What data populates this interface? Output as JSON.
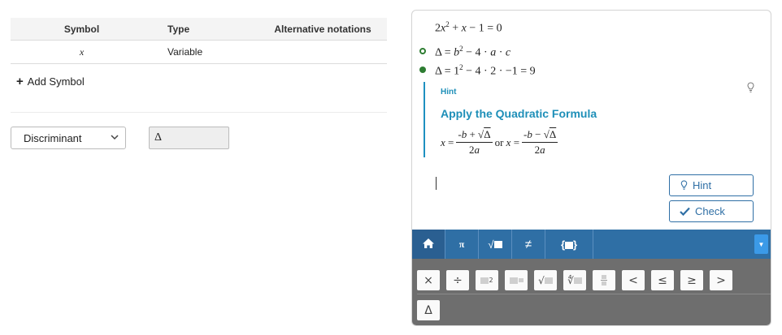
{
  "symbol_table": {
    "headers": [
      "Symbol",
      "Type",
      "Alternative notations"
    ],
    "rows": [
      {
        "symbol": "x",
        "type": "Variable",
        "alt": ""
      }
    ]
  },
  "add_symbol_label": "Add Symbol",
  "symbol_select": {
    "selected": "Discriminant"
  },
  "symbol_value": "Δ",
  "solution": {
    "equation": "2x² + x − 1 = 0",
    "steps": [
      {
        "text": "Δ = b² − 4 · a · c",
        "state": "open"
      },
      {
        "text": "Δ = 1² − 4 · 2 · −1 = 9",
        "state": "done"
      }
    ]
  },
  "hint": {
    "label": "Hint",
    "title": "Apply the Quadratic Formula",
    "formula_connector": "or"
  },
  "buttons": {
    "hint": "Hint",
    "check": "Check"
  },
  "keyboard": {
    "tabs": [
      {
        "icon": "home-icon"
      },
      {
        "label": "π"
      },
      {
        "label": "√▪"
      },
      {
        "label": "≠"
      },
      {
        "label": "{▪}"
      }
    ],
    "keys_row1": [
      "×",
      "÷",
      "▪²",
      "▪▪",
      "√▪",
      "∜▪",
      "▪/▪",
      "<",
      "≤",
      "≥",
      ">"
    ],
    "keys_row2": [
      "Δ"
    ]
  },
  "colors": {
    "accent": "#2f6fa5",
    "hint_accent": "#1e8fb8",
    "step_green": "#2e7d32",
    "keyboard_bg": "#6e6e6e"
  }
}
